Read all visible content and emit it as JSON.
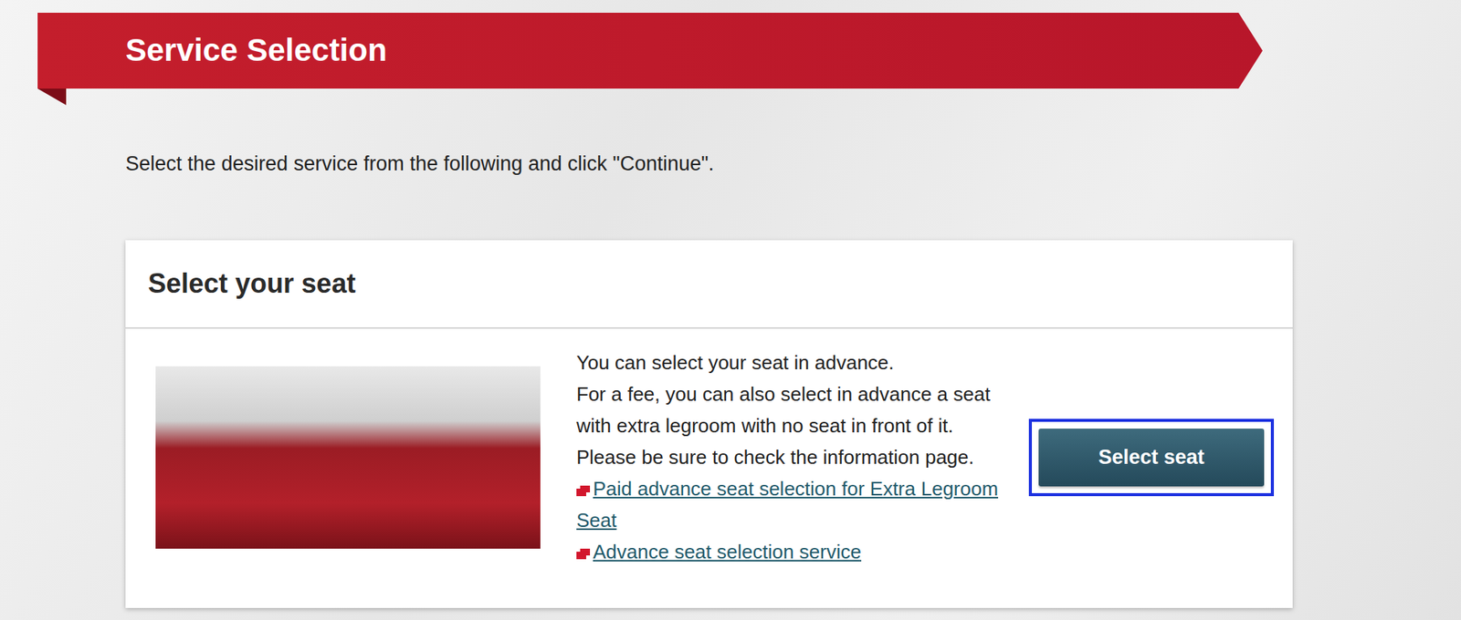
{
  "page": {
    "title": "Service Selection",
    "instruction": "Select the desired service from the following and click \"Continue\"."
  },
  "card": {
    "heading": "Select your seat",
    "description": [
      "You can select your seat in advance.",
      "For a fee, you can also select in advance a seat with extra legroom with no seat in front of it. Please be sure to check the information page."
    ],
    "links": [
      {
        "label": "Paid advance seat selection for Extra Legroom Seat"
      },
      {
        "label": "Advance seat selection service"
      }
    ],
    "button": {
      "label": "Select seat",
      "focused": true
    }
  }
}
